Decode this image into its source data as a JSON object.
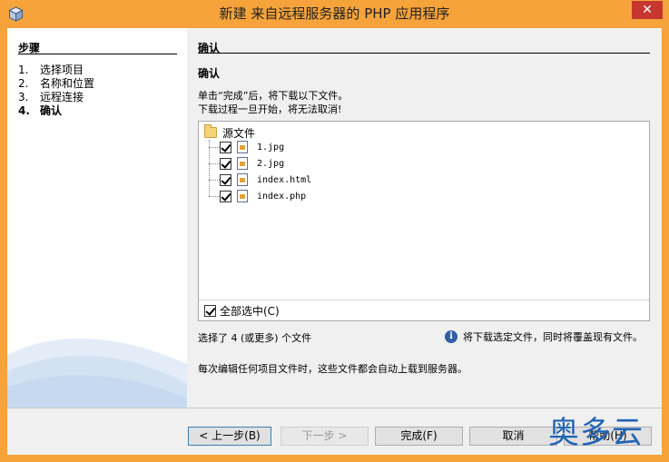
{
  "window": {
    "title": "新建 来自远程服务器的 PHP 应用程序",
    "close_label": "✕"
  },
  "steps": {
    "title": "步骤",
    "items": [
      {
        "num": "1.",
        "label": "选择项目"
      },
      {
        "num": "2.",
        "label": "名称和位置"
      },
      {
        "num": "3.",
        "label": "远程连接"
      },
      {
        "num": "4.",
        "label": "确认"
      }
    ],
    "active_index": 3
  },
  "main": {
    "section_title": "确认",
    "sub_title": "确认",
    "instruction_1": "单击“完成”后，将下载以下文件。",
    "instruction_2": "下载过程一旦开始，将无法取消!",
    "tree": {
      "root_label": "源文件",
      "files": [
        {
          "name": "1.jpg",
          "checked": true
        },
        {
          "name": "2.jpg",
          "checked": true
        },
        {
          "name": "index.html",
          "checked": true
        },
        {
          "name": "index.php",
          "checked": true
        }
      ],
      "select_all_label": "全部选中(C)",
      "select_all_checked": true
    },
    "selected_count_text": "选择了 4 (或更多) 个文件",
    "info_text": "将下载选定文件，同时将覆盖现有文件。",
    "autosync_text": "每次编辑任何项目文件时，这些文件都会自动上载到服务器。"
  },
  "buttons": {
    "back": "< 上一步(B)",
    "next": "下一步 >",
    "finish": "完成(F)",
    "cancel": "取消",
    "help": "帮助(H)"
  },
  "watermark": "奥多云",
  "colors": {
    "titlebar": "#f5a33a",
    "close": "#c7372f",
    "watermark": "#1f63b5"
  }
}
